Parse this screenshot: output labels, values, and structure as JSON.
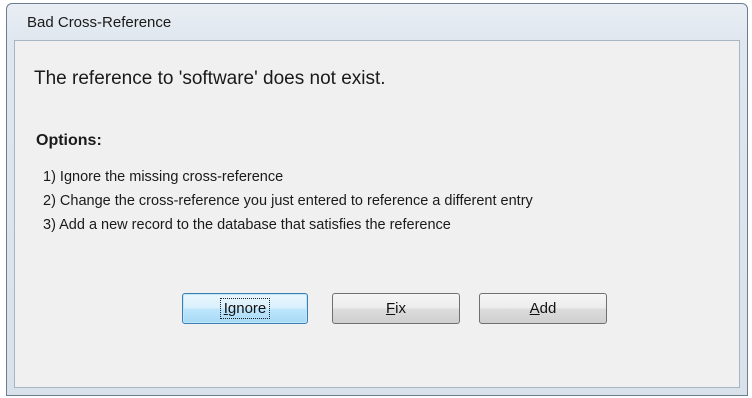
{
  "window": {
    "title": "Bad Cross-Reference"
  },
  "message": "The reference to 'software' does not exist.",
  "options": {
    "heading": "Options:",
    "items": [
      "1) Ignore the missing cross-reference",
      "2) Change the cross-reference you just entered to reference a different entry",
      "3) Add a new record to the database that satisfies the reference"
    ]
  },
  "buttons": {
    "ignore": {
      "label": "Ignore",
      "mnemonic": "I",
      "rest": "gnore",
      "is_default": true
    },
    "fix": {
      "label": "Fix",
      "mnemonic": "F",
      "rest": "ix",
      "is_default": false
    },
    "add": {
      "label": "Add",
      "mnemonic": "A",
      "rest": "dd",
      "is_default": false
    }
  }
}
